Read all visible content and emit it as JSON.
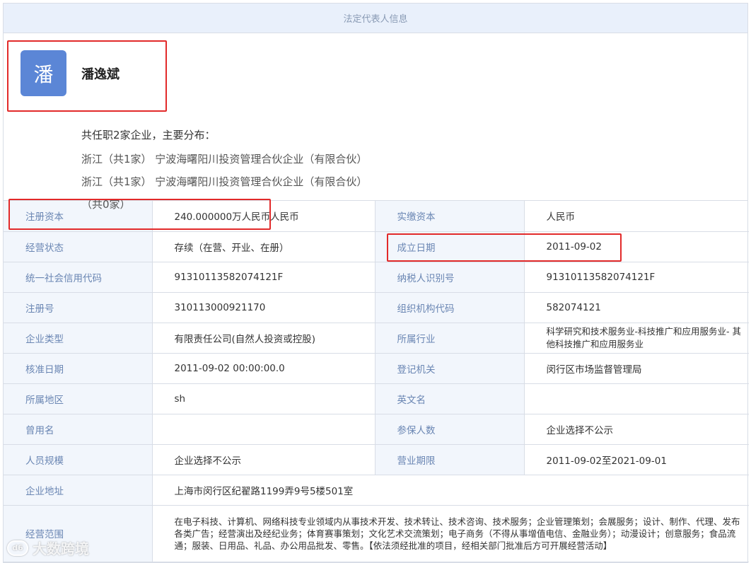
{
  "header": {
    "title": "法定代表人信息"
  },
  "person": {
    "avatar_char": "潘",
    "name": "潘逸斌",
    "summary": "共任职2家企业，主要分布：",
    "lines": [
      "浙江（共1家） 宁波海曙阳川投资管理合伙企业（有限合伙）",
      "浙江（共1家） 宁波海曙阳川投资管理合伙企业（有限合伙）",
      "（共0家）"
    ]
  },
  "rows": [
    {
      "k1": "注册资本",
      "v1": "240.000000万人民币人民币",
      "k2": "实缴资本",
      "v2": "人民币"
    },
    {
      "k1": "经营状态",
      "v1": "存续（在营、开业、在册）",
      "k2": "成立日期",
      "v2": "2011-09-02"
    },
    {
      "k1": "统一社会信用代码",
      "v1": "91310113582074121F",
      "k2": "纳税人识别号",
      "v2": "91310113582074121F"
    },
    {
      "k1": "注册号",
      "v1": "310113000921170",
      "k2": "组织机构代码",
      "v2": "582074121"
    },
    {
      "k1": "企业类型",
      "v1": "有限责任公司(自然人投资或控股)",
      "k2": "所属行业",
      "v2": "科学研究和技术服务业-科技推广和应用服务业- 其他科技推广和应用服务业"
    },
    {
      "k1": "核准日期",
      "v1": "2011-09-02 00:00:00.0",
      "k2": "登记机关",
      "v2": "闵行区市场监督管理局"
    },
    {
      "k1": "所属地区",
      "v1": "sh",
      "k2": "英文名",
      "v2": ""
    },
    {
      "k1": "曾用名",
      "v1": "",
      "k2": "参保人数",
      "v2": "企业选择不公示"
    },
    {
      "k1": "人员规模",
      "v1": "企业选择不公示",
      "k2": "营业期限",
      "v2": "2011-09-02至2021-09-01"
    }
  ],
  "address": {
    "label": "企业地址",
    "value": "上海市闵行区纪翟路1199弄9号5楼501室"
  },
  "scope": {
    "label": "经营范围",
    "value": "在电子科技、计算机、网络科技专业领域内从事技术开发、技术转让、技术咨询、技术服务；企业管理策划；会展服务；设计、制作、代理、发布各类广告；经营演出及经纪业务；体育赛事策划；文化艺术交流策划；电子商务（不得从事增值电信、金融业务）；动漫设计；创意服务；食品流通；服装、日用品、礼品、办公用品批发、零售。【依法须经批准的项目，经相关部门批准后方可开展经营活动】"
  },
  "watermark": {
    "text": "大数跨境",
    "logo": "d6"
  },
  "colors": {
    "highlight": "#e22a2a",
    "avatar_bg": "#5b86d6",
    "label_text": "#6a86b3",
    "label_bg": "#f2f6fc"
  }
}
